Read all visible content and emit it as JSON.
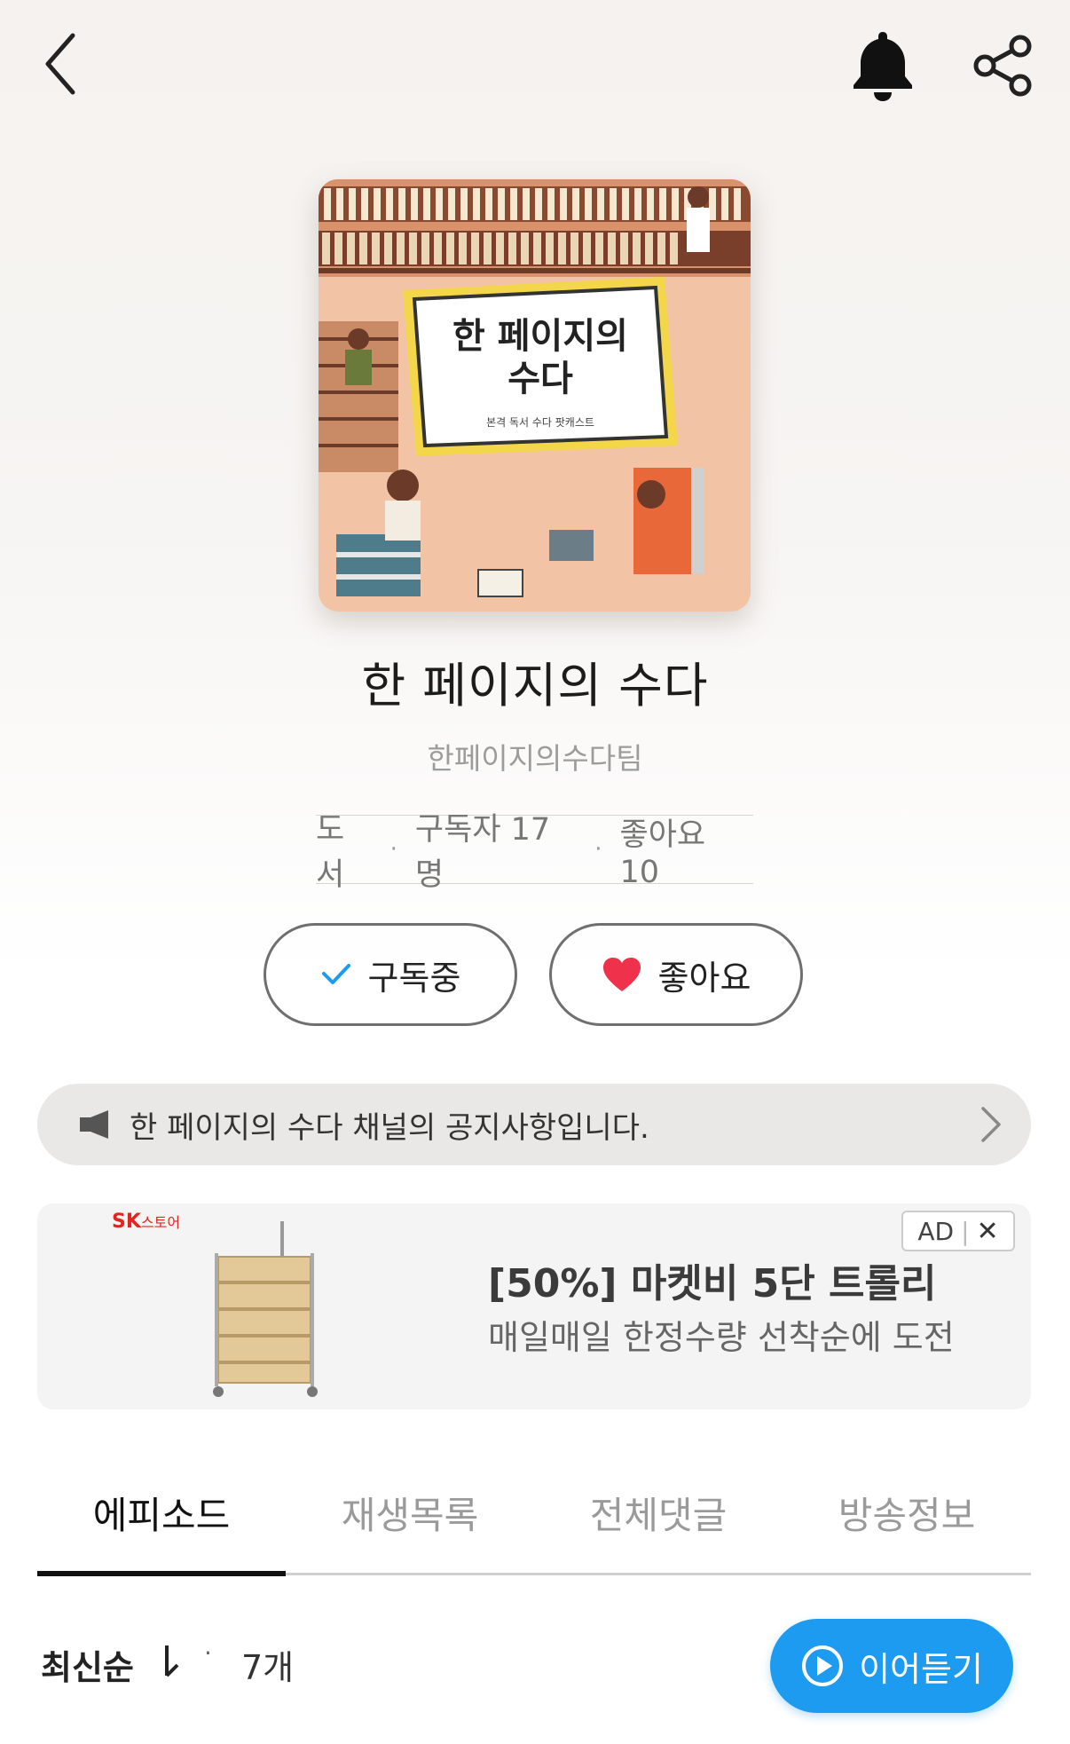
{
  "header": {
    "back_icon": "chevron-left-icon",
    "bell_icon": "bell-icon",
    "share_icon": "share-icon"
  },
  "cover": {
    "title_line1": "한 페이지의",
    "title_line2": "수다",
    "tagline": "본격 독서 수다 팟캐스트"
  },
  "channel": {
    "title": "한 페이지의 수다",
    "author": "한페이지의수다팀",
    "category": "도서",
    "subscribers": "구독자 17명",
    "likes": "좋아요 10"
  },
  "actions": {
    "subscribe_label": "구독중",
    "like_label": "좋아요",
    "heart_color": "#f0314b",
    "check_color": "#1d9bf0"
  },
  "notice": {
    "text": "한 페이지의 수다 채널의 공지사항입니다."
  },
  "ad": {
    "logo": "SK",
    "logo_sub": "스토어",
    "title": "[50%] 마켓비 5단 트롤리",
    "description": "매일매일 한정수량 선착순에 도전",
    "badge": "AD",
    "close": "✕"
  },
  "tabs": [
    {
      "label": "에피소드",
      "active": true
    },
    {
      "label": "재생목록",
      "active": false
    },
    {
      "label": "전체댓글",
      "active": false
    },
    {
      "label": "방송정보",
      "active": false
    }
  ],
  "list": {
    "sort_label": "최신순",
    "dot": "·",
    "count": "7개",
    "continue_label": "이어듣기",
    "accent": "#1d9bf0"
  }
}
